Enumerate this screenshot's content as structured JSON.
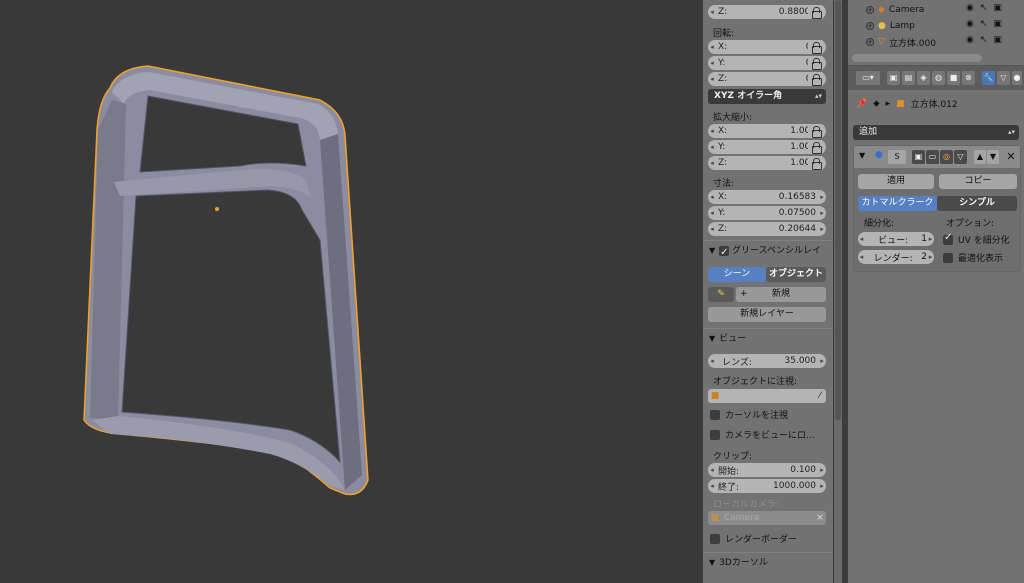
{
  "npanel": {
    "location_z": {
      "label": "Z:",
      "value": "0.88000"
    },
    "rotation": {
      "title": "回転:",
      "x": {
        "label": "X:",
        "value": "0°"
      },
      "y": {
        "label": "Y:",
        "value": "0°"
      },
      "z": {
        "label": "Z:",
        "value": "0°"
      },
      "mode": "XYZ オイラー角"
    },
    "scale": {
      "title": "拡大縮小:",
      "x": {
        "label": "X:",
        "value": "1.000"
      },
      "y": {
        "label": "Y:",
        "value": "1.000"
      },
      "z": {
        "label": "Z:",
        "value": "1.000"
      }
    },
    "dimensions": {
      "title": "寸法:",
      "x": {
        "label": "X:",
        "value": "0.16583"
      },
      "y": {
        "label": "Y:",
        "value": "0.07500"
      },
      "z": {
        "label": "Z:",
        "value": "0.20644"
      }
    },
    "grease_pencil": {
      "title": "グリースペンシルレイ",
      "tab_scene": "シーン",
      "tab_object": "オブジェクト",
      "new_label": "新規",
      "new_layer_label": "新規レイヤー"
    },
    "view": {
      "title": "ビュー",
      "lens": {
        "label": "レンズ:",
        "value": "35.000"
      },
      "lock_to_object": "オブジェクトに注視:",
      "lock_cursor": "カーソルを注視",
      "lock_camera": "カメラをビューにロ...",
      "clip_title": "クリップ:",
      "clip_start": {
        "label": "開始:",
        "value": "0.100"
      },
      "clip_end": {
        "label": "終了:",
        "value": "1000.000"
      },
      "local_camera_title": "ローカルカメラ:",
      "local_camera_value": "Camera",
      "render_border": "レンダーボーダー"
    },
    "cursor3d": {
      "title": "3Dカーソル"
    }
  },
  "outliner": {
    "items": [
      {
        "name": "Camera"
      },
      {
        "name": "Lamp"
      },
      {
        "name": "立方体.000"
      }
    ]
  },
  "properties": {
    "object_name": "立方体.012",
    "add_modifier": "追加",
    "modifier": {
      "name": "S",
      "apply": "適用",
      "copy": "コピー",
      "type_catmull": "カトマルクラーク",
      "type_simple": "シンプル",
      "subdivisions_label": "細分化:",
      "view_field": {
        "label": "ビュー:",
        "value": "1"
      },
      "render_field": {
        "label": "レンダー:",
        "value": "2"
      },
      "options_label": "オプション:",
      "uv_subdivide": "UV を細分化",
      "optimal_display": "最適化表示"
    }
  },
  "colors": {
    "viewport_bg": "#393939",
    "panel_bg": "#727272",
    "selection_orange": "#f2a227",
    "mesh_fill": "#8a8a98",
    "active_blue": "#5680c2"
  }
}
